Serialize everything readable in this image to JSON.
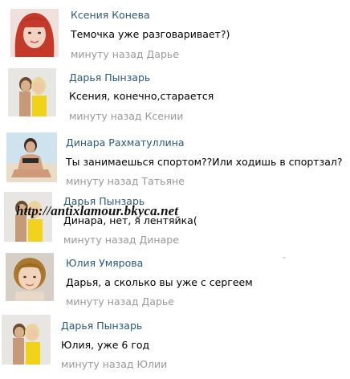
{
  "comments": [
    {
      "name": "Ксения Конева",
      "text": "Темочка уже разговаривает?)",
      "meta": "минуту назад Дарье",
      "avatar": "ksenia-avatar"
    },
    {
      "name": "Дарья Пынзарь",
      "text": "Ксения, конечно,старается",
      "meta": "минуту назад Ксении",
      "avatar": "darya-avatar"
    },
    {
      "name": "Динара Рахматуллина",
      "text": "Ты занимаешься спортом??Или ходишь в спортзал?",
      "meta": "минуту назад Татьяне",
      "avatar": "dinara-avatar"
    },
    {
      "name": "Дарья Пынзарь",
      "text": "Динара, нет, я лентяйка(",
      "meta": "минуту назад Динаре",
      "avatar": "darya-avatar"
    },
    {
      "name": "Юлия Умярова",
      "text": "Дарья, а сколько вы уже с сергеем",
      "meta": "минуту назад Дарье",
      "avatar": "yulia-avatar"
    },
    {
      "name": "Дарья Пынзарь",
      "text": "Юлия, уже 6 год",
      "meta": "минуту назад Юлии",
      "avatar": "darya-avatar"
    }
  ],
  "watermark": "http://antixlamour.bkyca.net",
  "colors": {
    "name_link": "#2b587a",
    "text": "#000000",
    "meta": "#999999"
  }
}
